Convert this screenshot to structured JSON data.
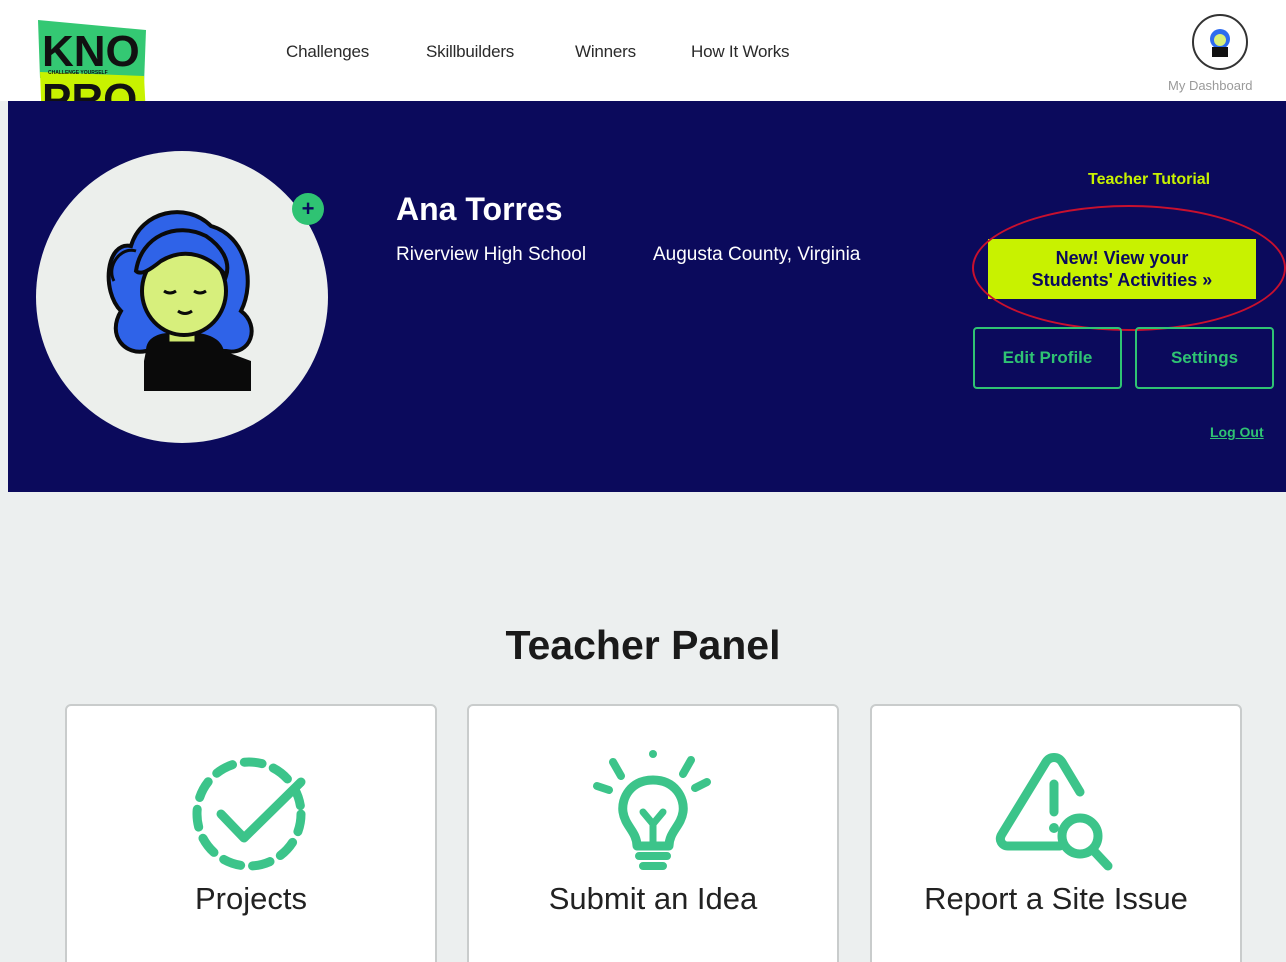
{
  "logo": {
    "line1": "KNO",
    "tagline": "CHALLENGE YOURSELF",
    "line2": "PRO"
  },
  "nav": {
    "items": [
      "Challenges",
      "Skillbuilders",
      "Winners",
      "How It Works"
    ],
    "dashboard_label": "My Dashboard"
  },
  "profile": {
    "name": "Ana Torres",
    "school": "Riverview High School",
    "location": "Augusta County, Virginia",
    "tutorial_link": "Teacher Tutorial",
    "activities_button_line1": "New! View your",
    "activities_button_line2": "Students' Activities »",
    "edit_button": "Edit Profile",
    "settings_button": "Settings",
    "logout_link": "Log Out"
  },
  "panel": {
    "title": "Teacher Panel",
    "cards": [
      {
        "label": "Projects",
        "icon": "dashed-check-circle-icon"
      },
      {
        "label": "Submit an Idea",
        "icon": "lightbulb-icon"
      },
      {
        "label": "Report a Site Issue",
        "icon": "warning-search-icon"
      }
    ]
  },
  "colors": {
    "navy": "#0b0a5c",
    "lime": "#c8f200",
    "green": "#2fc373",
    "icon_green": "#3cc48a",
    "highlight_red": "#c8102e",
    "background": "#ecefef"
  }
}
